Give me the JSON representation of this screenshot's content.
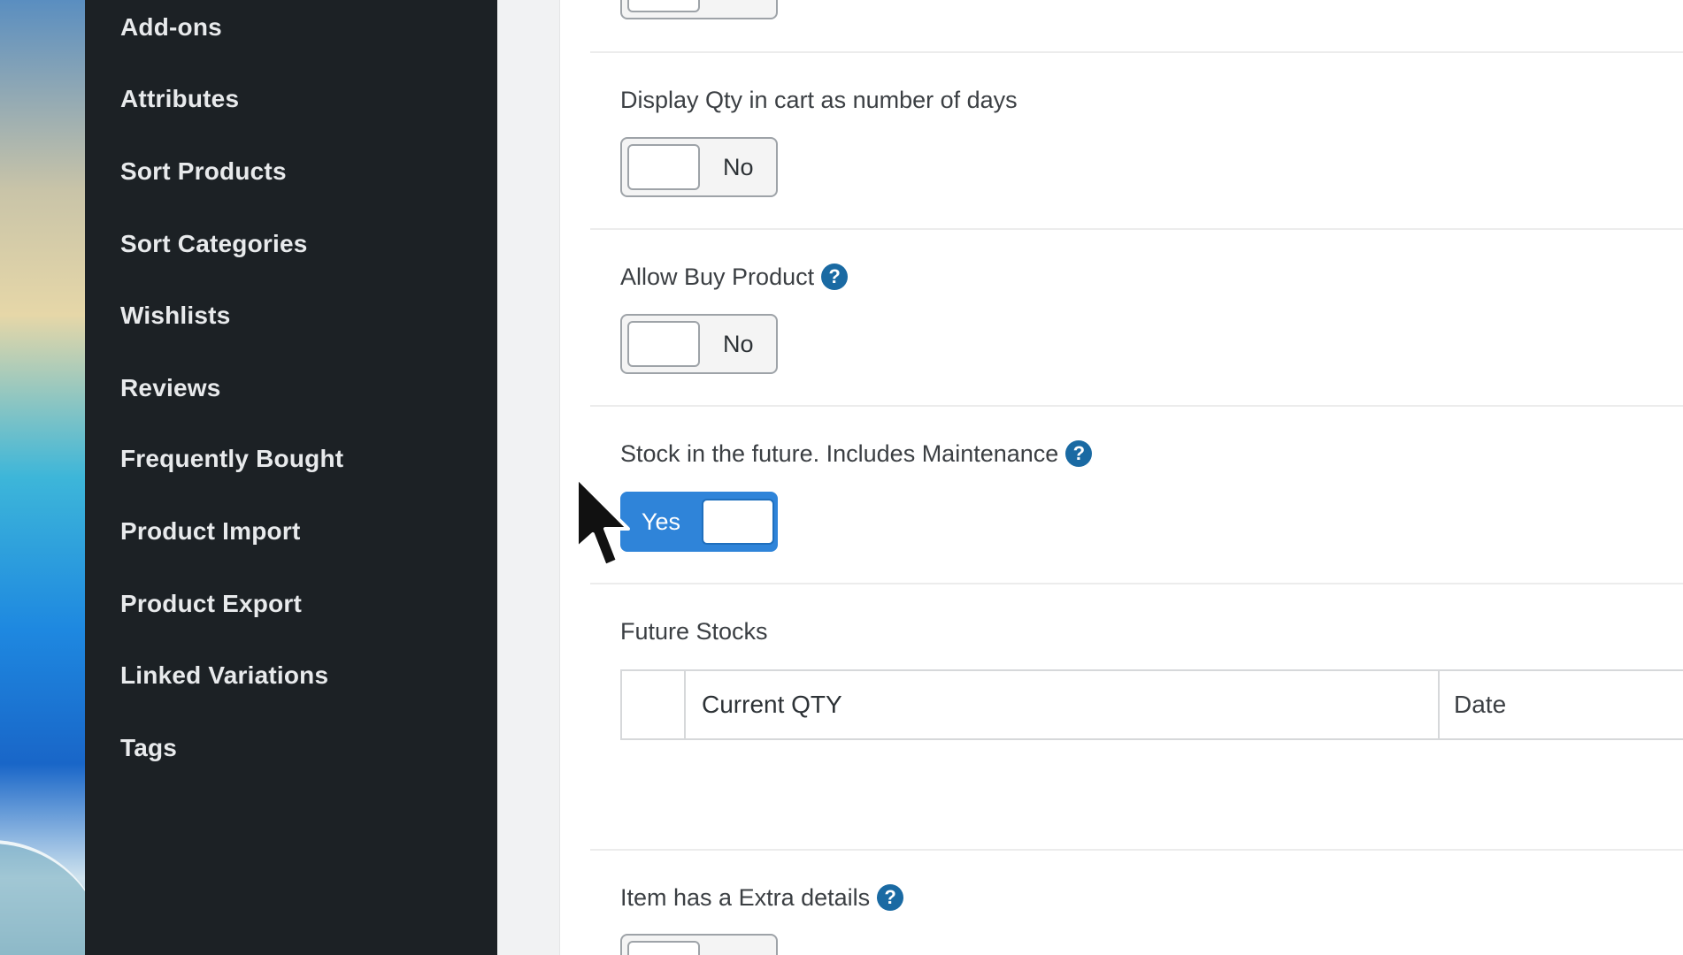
{
  "sidebar": {
    "items": [
      {
        "label": "Add-ons"
      },
      {
        "label": "Attributes"
      },
      {
        "label": "Sort Products"
      },
      {
        "label": "Sort Categories"
      },
      {
        "label": "Wishlists"
      },
      {
        "label": "Reviews"
      },
      {
        "label": "Frequently Bought"
      },
      {
        "label": "Product Import"
      },
      {
        "label": "Product Export"
      },
      {
        "label": "Linked Variations"
      },
      {
        "label": "Tags"
      }
    ]
  },
  "fields": {
    "display_qty": {
      "label": "Display Qty in cart as number of days",
      "toggle_text": "No",
      "enabled": false
    },
    "allow_buy": {
      "label": "Allow Buy Product",
      "toggle_text": "No",
      "enabled": false
    },
    "stock_future": {
      "label": "Stock in the future. Includes Maintenance",
      "toggle_text": "Yes",
      "enabled": true
    },
    "future_stocks": {
      "label": "Future Stocks",
      "columns": [
        "",
        "Current QTY",
        "Date"
      ]
    },
    "extra_details": {
      "label": "Item has a Extra details"
    }
  },
  "icons": {
    "help": "?",
    "help_color": "#1a6aa3",
    "toggle_on_color": "#2f84d9"
  }
}
